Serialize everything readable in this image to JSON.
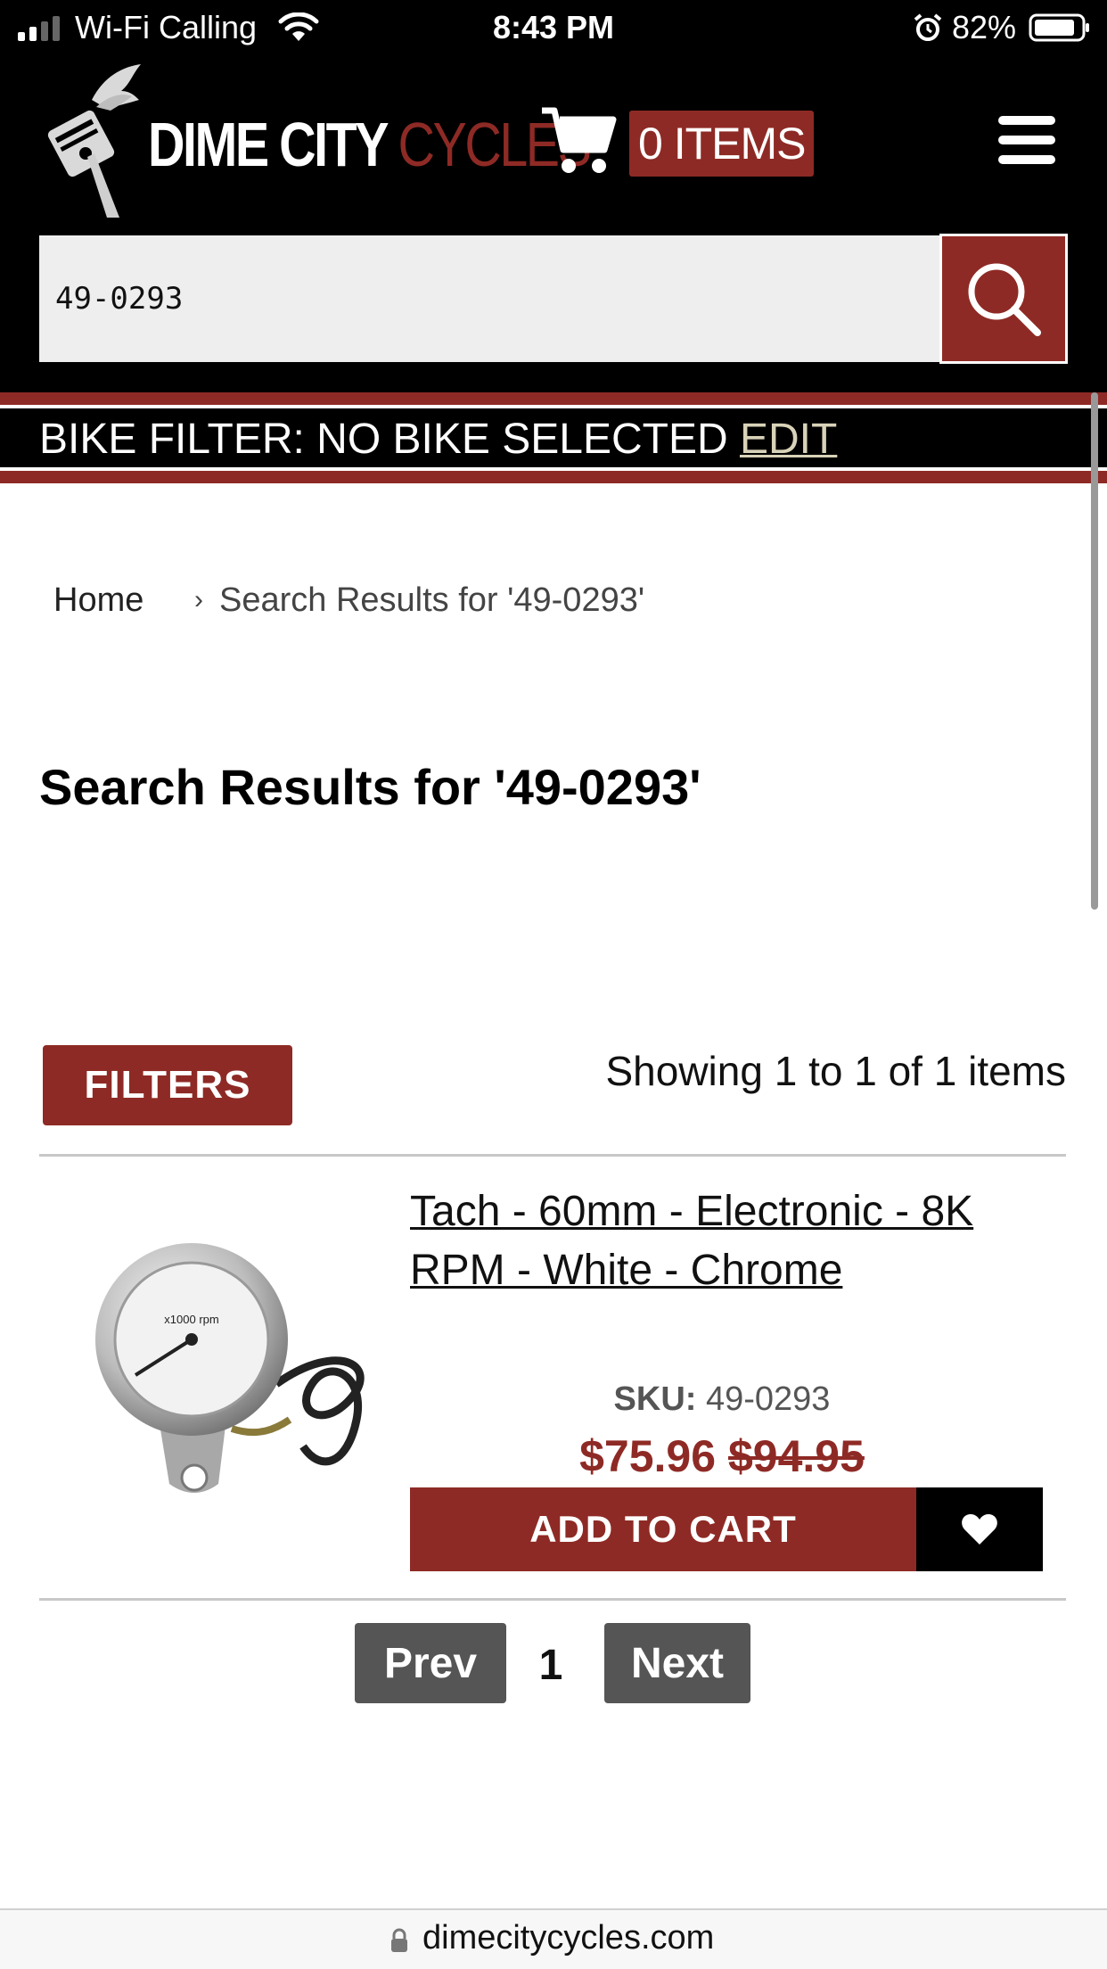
{
  "status_bar": {
    "carrier": "Wi-Fi Calling",
    "time": "8:43 PM",
    "battery": "82%"
  },
  "header": {
    "brand_white": "DIME CITY",
    "brand_red": "CYCLES",
    "cart_count": "0 ITEMS",
    "search_value": "49-0293",
    "brand_color": "#8e2a25"
  },
  "bike_filter": {
    "label": "BIKE FILTER: NO BIKE SELECTED",
    "edit": "EDIT"
  },
  "breadcrumb": {
    "home": "Home",
    "separator": "›",
    "current": "Search Results for '49-0293'"
  },
  "page": {
    "title": "Search Results for '49-0293'",
    "filters_label": "FILTERS",
    "results_count": "Showing 1 to 1 of 1 items"
  },
  "product": {
    "title": "Tach - 60mm - Electronic - 8K RPM - White - Chrome",
    "sku_label": "SKU:",
    "sku_value": "49-0293",
    "price_sale": "$75.96",
    "price_original": "$94.95",
    "add_to_cart": "ADD TO CART",
    "gauge_text": "x1000 rpm"
  },
  "pagination": {
    "prev": "Prev",
    "current": "1",
    "next": "Next"
  },
  "url_bar": {
    "domain": "dimecitycycles.com"
  }
}
